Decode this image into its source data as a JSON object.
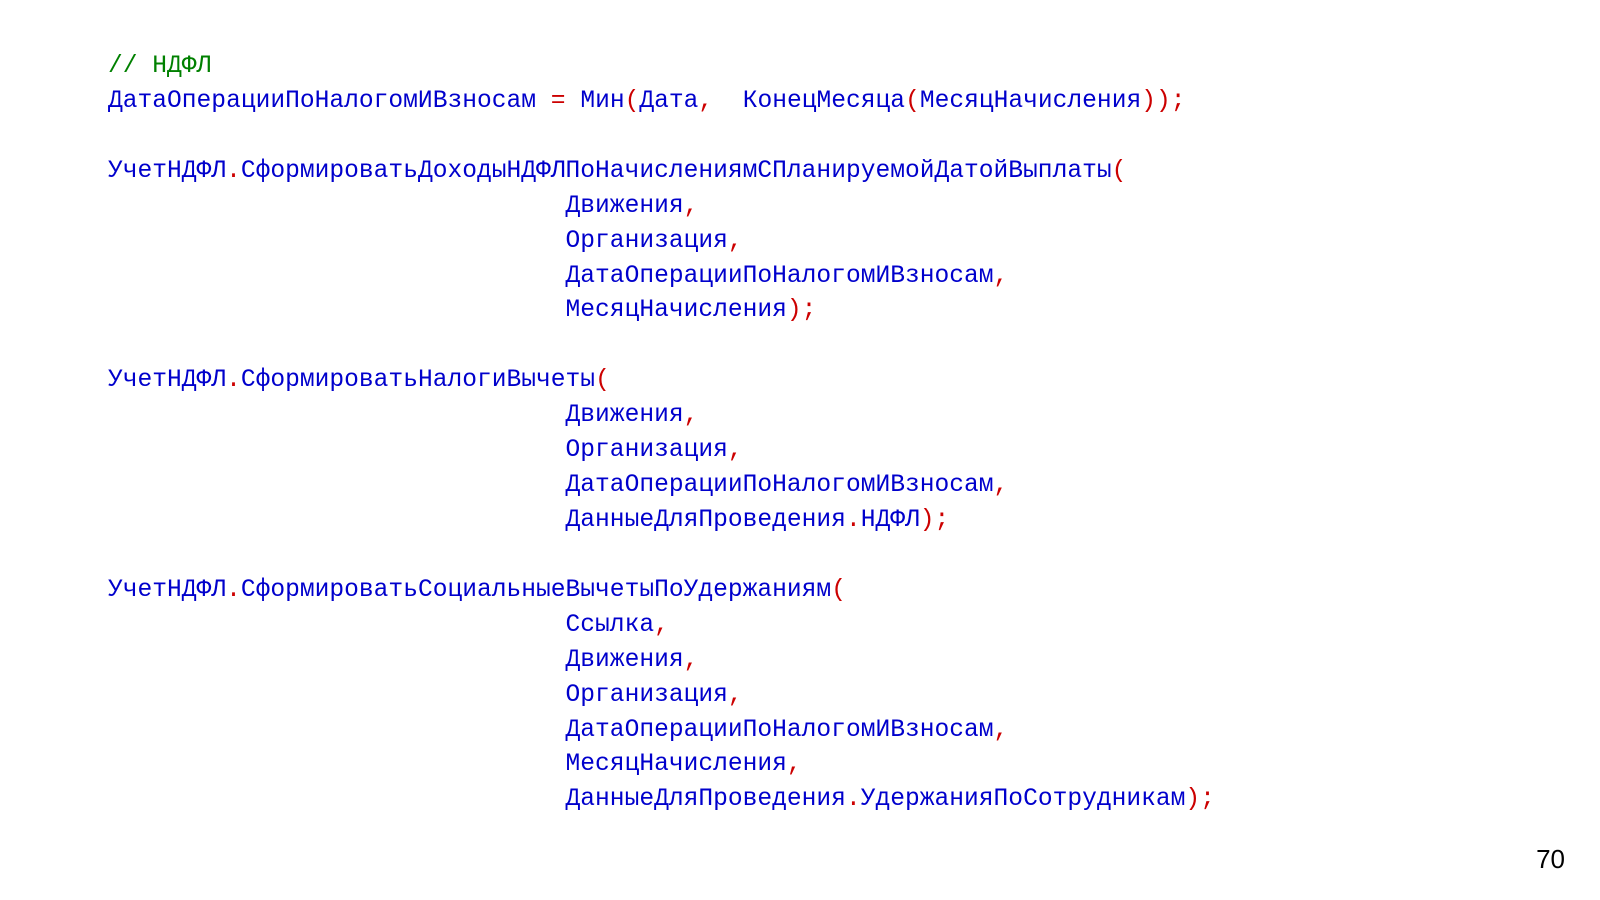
{
  "page_number": "70",
  "tokens": [
    {
      "cls": "c",
      "t": "// НДФЛ"
    },
    {
      "cls": "",
      "t": "\n"
    },
    {
      "cls": "id",
      "t": "ДатаОперацииПоНалогомИВзносам"
    },
    {
      "cls": "",
      "t": " "
    },
    {
      "cls": "pn",
      "t": "="
    },
    {
      "cls": "",
      "t": " "
    },
    {
      "cls": "id",
      "t": "Мин"
    },
    {
      "cls": "pn",
      "t": "("
    },
    {
      "cls": "id",
      "t": "Дата"
    },
    {
      "cls": "pn",
      "t": ","
    },
    {
      "cls": "",
      "t": "  "
    },
    {
      "cls": "id",
      "t": "КонецМесяца"
    },
    {
      "cls": "pn",
      "t": "("
    },
    {
      "cls": "id",
      "t": "МесяцНачисления"
    },
    {
      "cls": "pn",
      "t": "));"
    },
    {
      "cls": "",
      "t": "\n\n"
    },
    {
      "cls": "id",
      "t": "УчетНДФЛ"
    },
    {
      "cls": "pn",
      "t": "."
    },
    {
      "cls": "id",
      "t": "СформироватьДоходыНДФЛПоНачислениямСПланируемойДатойВыплаты"
    },
    {
      "cls": "pn",
      "t": "("
    },
    {
      "cls": "",
      "t": "\n                               "
    },
    {
      "cls": "id",
      "t": "Движения"
    },
    {
      "cls": "pn",
      "t": ","
    },
    {
      "cls": "",
      "t": "\n                               "
    },
    {
      "cls": "id",
      "t": "Организация"
    },
    {
      "cls": "pn",
      "t": ","
    },
    {
      "cls": "",
      "t": "\n                               "
    },
    {
      "cls": "id",
      "t": "ДатаОперацииПоНалогомИВзносам"
    },
    {
      "cls": "pn",
      "t": ","
    },
    {
      "cls": "",
      "t": "\n                               "
    },
    {
      "cls": "id",
      "t": "МесяцНачисления"
    },
    {
      "cls": "pn",
      "t": ");"
    },
    {
      "cls": "",
      "t": "\n\n"
    },
    {
      "cls": "id",
      "t": "УчетНДФЛ"
    },
    {
      "cls": "pn",
      "t": "."
    },
    {
      "cls": "id",
      "t": "СформироватьНалогиВычеты"
    },
    {
      "cls": "pn",
      "t": "("
    },
    {
      "cls": "",
      "t": "\n                               "
    },
    {
      "cls": "id",
      "t": "Движения"
    },
    {
      "cls": "pn",
      "t": ","
    },
    {
      "cls": "",
      "t": "\n                               "
    },
    {
      "cls": "id",
      "t": "Организация"
    },
    {
      "cls": "pn",
      "t": ","
    },
    {
      "cls": "",
      "t": "\n                               "
    },
    {
      "cls": "id",
      "t": "ДатаОперацииПоНалогомИВзносам"
    },
    {
      "cls": "pn",
      "t": ","
    },
    {
      "cls": "",
      "t": "\n                               "
    },
    {
      "cls": "id",
      "t": "ДанныеДляПроведения"
    },
    {
      "cls": "pn",
      "t": "."
    },
    {
      "cls": "id",
      "t": "НДФЛ"
    },
    {
      "cls": "pn",
      "t": ");"
    },
    {
      "cls": "",
      "t": "\n\n"
    },
    {
      "cls": "id",
      "t": "УчетНДФЛ"
    },
    {
      "cls": "pn",
      "t": "."
    },
    {
      "cls": "id",
      "t": "СформироватьСоциальныеВычетыПоУдержаниям"
    },
    {
      "cls": "pn",
      "t": "("
    },
    {
      "cls": "",
      "t": "\n                               "
    },
    {
      "cls": "id",
      "t": "Ссылка"
    },
    {
      "cls": "pn",
      "t": ","
    },
    {
      "cls": "",
      "t": "\n                               "
    },
    {
      "cls": "id",
      "t": "Движения"
    },
    {
      "cls": "pn",
      "t": ","
    },
    {
      "cls": "",
      "t": "\n                               "
    },
    {
      "cls": "id",
      "t": "Организация"
    },
    {
      "cls": "pn",
      "t": ","
    },
    {
      "cls": "",
      "t": "\n                               "
    },
    {
      "cls": "id",
      "t": "ДатаОперацииПоНалогомИВзносам"
    },
    {
      "cls": "pn",
      "t": ","
    },
    {
      "cls": "",
      "t": "\n                               "
    },
    {
      "cls": "id",
      "t": "МесяцНачисления"
    },
    {
      "cls": "pn",
      "t": ","
    },
    {
      "cls": "",
      "t": "\n                               "
    },
    {
      "cls": "id",
      "t": "ДанныеДляПроведения"
    },
    {
      "cls": "pn",
      "t": "."
    },
    {
      "cls": "id",
      "t": "УдержанияПоСотрудникам"
    },
    {
      "cls": "pn",
      "t": ");"
    }
  ]
}
